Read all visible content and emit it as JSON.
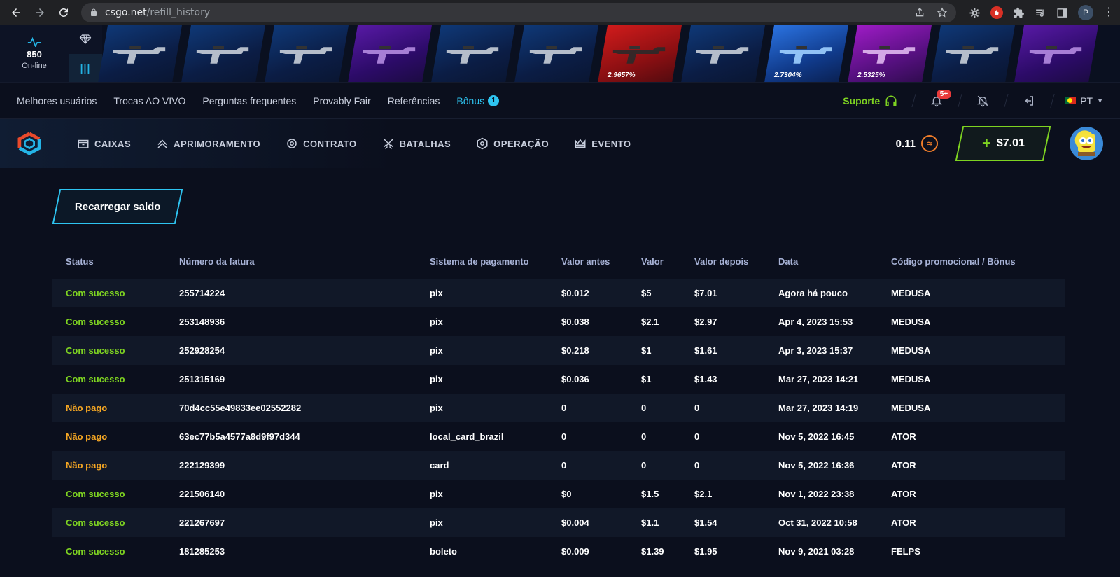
{
  "browser": {
    "url_domain": "csgo.net",
    "url_path": "/refill_history",
    "profile_initial": "P"
  },
  "strip": {
    "online_count": "850",
    "online_label": "On-line",
    "filter_label": "|||",
    "drops": [
      {
        "rarity": "blue",
        "pct": ""
      },
      {
        "rarity": "blue",
        "pct": ""
      },
      {
        "rarity": "blue",
        "pct": ""
      },
      {
        "rarity": "purple",
        "pct": ""
      },
      {
        "rarity": "blue",
        "pct": ""
      },
      {
        "rarity": "blue",
        "pct": ""
      },
      {
        "rarity": "red",
        "pct": "2.9657%"
      },
      {
        "rarity": "blue",
        "pct": ""
      },
      {
        "rarity": "lightblue",
        "pct": "2.7304%"
      },
      {
        "rarity": "pink",
        "pct": "2.5325%"
      },
      {
        "rarity": "blue",
        "pct": ""
      },
      {
        "rarity": "purple",
        "pct": ""
      }
    ]
  },
  "topnav": {
    "links": [
      "Melhores usuários",
      "Trocas AO VIVO",
      "Perguntas frequentes",
      "Provably Fair",
      "Referências"
    ],
    "bonus_label": "Bônus",
    "bonus_count": "1",
    "support_label": "Suporte",
    "notifications_badge": "5+",
    "language": "PT"
  },
  "mainnav": {
    "items": [
      {
        "label": "CAIXAS",
        "icon": "box-icon"
      },
      {
        "label": "APRIMORAMENTO",
        "icon": "upgrade-chevrons-icon"
      },
      {
        "label": "CONTRATO",
        "icon": "contract-target-icon"
      },
      {
        "label": "BATALHAS",
        "icon": "crossed-swords-icon"
      },
      {
        "label": "OPERAÇÃO",
        "icon": "hexagon-icon"
      },
      {
        "label": "EVENTO",
        "icon": "crown-icon"
      }
    ],
    "coins": "0.11",
    "balance_plus": "+",
    "balance": "$7.01"
  },
  "refill_button": "Recarregar saldo",
  "table": {
    "headers": [
      "Status",
      "Número da fatura",
      "Sistema de pagamento",
      "Valor antes",
      "Valor",
      "Valor depois",
      "Data",
      "Código promocional / Bônus"
    ],
    "rows": [
      {
        "status": "Com sucesso",
        "state": "ok",
        "invoice": "255714224",
        "system": "pix",
        "before": "$0.012",
        "amount": "$5",
        "after": "$7.01",
        "date": "Agora há pouco",
        "promo": "MEDUSA"
      },
      {
        "status": "Com sucesso",
        "state": "ok",
        "invoice": "253148936",
        "system": "pix",
        "before": "$0.038",
        "amount": "$2.1",
        "after": "$2.97",
        "date": "Apr 4, 2023 15:53",
        "promo": "MEDUSA"
      },
      {
        "status": "Com sucesso",
        "state": "ok",
        "invoice": "252928254",
        "system": "pix",
        "before": "$0.218",
        "amount": "$1",
        "after": "$1.61",
        "date": "Apr 3, 2023 15:37",
        "promo": "MEDUSA"
      },
      {
        "status": "Com sucesso",
        "state": "ok",
        "invoice": "251315169",
        "system": "pix",
        "before": "$0.036",
        "amount": "$1",
        "after": "$1.43",
        "date": "Mar 27, 2023 14:21",
        "promo": "MEDUSA"
      },
      {
        "status": "Não pago",
        "state": "unpaid",
        "invoice": "70d4cc55e49833ee02552282",
        "system": "pix",
        "before": "0",
        "amount": "0",
        "after": "0",
        "date": "Mar 27, 2023 14:19",
        "promo": "MEDUSA"
      },
      {
        "status": "Não pago",
        "state": "unpaid",
        "invoice": "63ec77b5a4577a8d9f97d344",
        "system": "local_card_brazil",
        "before": "0",
        "amount": "0",
        "after": "0",
        "date": "Nov 5, 2022 16:45",
        "promo": "ATOR"
      },
      {
        "status": "Não pago",
        "state": "unpaid",
        "invoice": "222129399",
        "system": "card",
        "before": "0",
        "amount": "0",
        "after": "0",
        "date": "Nov 5, 2022 16:36",
        "promo": "ATOR"
      },
      {
        "status": "Com sucesso",
        "state": "ok",
        "invoice": "221506140",
        "system": "pix",
        "before": "$0",
        "amount": "$1.5",
        "after": "$2.1",
        "date": "Nov 1, 2022 23:38",
        "promo": "ATOR"
      },
      {
        "status": "Com sucesso",
        "state": "ok",
        "invoice": "221267697",
        "system": "pix",
        "before": "$0.004",
        "amount": "$1.1",
        "after": "$1.54",
        "date": "Oct 31, 2022 10:58",
        "promo": "ATOR"
      },
      {
        "status": "Com sucesso",
        "state": "ok",
        "invoice": "181285253",
        "system": "boleto",
        "before": "$0.009",
        "amount": "$1.39",
        "after": "$1.95",
        "date": "Nov 9, 2021 03:28",
        "promo": "FELPS"
      }
    ]
  },
  "colors": {
    "accent_cyan": "#2ec4f1",
    "success_green": "#7ed321",
    "unpaid_orange": "#f5a623",
    "coin_orange": "#f07d2a",
    "notification_red": "#e83a3a"
  }
}
